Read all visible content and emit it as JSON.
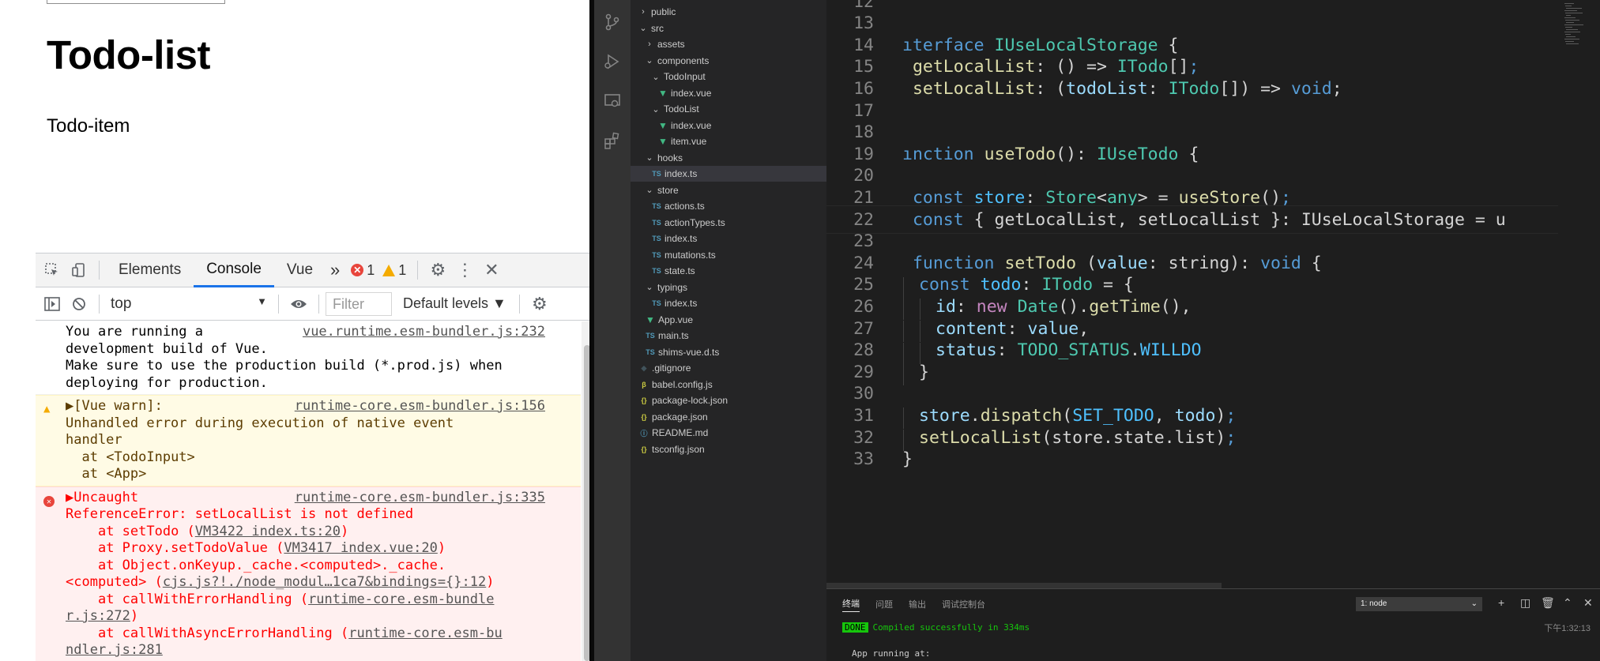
{
  "browser": {
    "page_title": "Todo-list",
    "page_item": "Todo-item",
    "devtools": {
      "tabs": [
        "Elements",
        "Console",
        "Vue"
      ],
      "more": "»",
      "error_count": "1",
      "warning_count": "1",
      "context": "top",
      "filter_placeholder": "Filter",
      "levels": "Default levels ▼"
    },
    "console": [
      {
        "type": "info",
        "source": "vue.runtime.esm-bundler.js:232",
        "text": "You are running a\ndevelopment build of Vue.\nMake sure to use the production build (*.prod.js) when\ndeploying for production."
      },
      {
        "type": "warn",
        "source": "runtime-core.esm-bundler.js:156",
        "text": "▶[Vue warn]:\nUnhandled error during execution of native event\nhandler\n  at <TodoInput>\n  at <App>"
      },
      {
        "type": "err",
        "source": "runtime-core.esm-bundler.js:335",
        "head": "▶Uncaught",
        "line1": "ReferenceError: setLocalList is not defined",
        "line2_pre": "    at setTodo (",
        "line2_link": "VM3422 index.ts:20",
        "line2_post": ")",
        "line3_pre": "    at Proxy.setTodoValue (",
        "line3_link": "VM3417 index.vue:20",
        "line3_post": ")",
        "line4": "    at Object.onKeyup._cache.<computed>._cache.",
        "line5_pre": "<computed> (",
        "line5_link": "cjs.js?!./node_modul…1ca7&bindings={}:12",
        "line5_post": ")",
        "line6_pre": "    at callWithErrorHandling (",
        "line6_link": "runtime-core.esm-bundle",
        "line7_link": "r.js:272",
        "line7_post": ")",
        "line8_pre": "    at callWithAsyncErrorHandling (",
        "line8_link": "runtime-core.esm-bu",
        "line9_link": "ndler.js:281"
      }
    ]
  },
  "explorer": [
    {
      "indent": 0,
      "chev": "›",
      "icon": "",
      "label": "public"
    },
    {
      "indent": 0,
      "chev": "⌄",
      "icon": "",
      "label": "src"
    },
    {
      "indent": 1,
      "chev": "›",
      "icon": "",
      "label": "assets"
    },
    {
      "indent": 1,
      "chev": "⌄",
      "icon": "",
      "label": "components"
    },
    {
      "indent": 2,
      "chev": "⌄",
      "icon": "",
      "label": "TodoInput"
    },
    {
      "indent": 3,
      "chev": "",
      "icon": "vue",
      "label": "index.vue"
    },
    {
      "indent": 2,
      "chev": "⌄",
      "icon": "",
      "label": "TodoList"
    },
    {
      "indent": 3,
      "chev": "",
      "icon": "vue",
      "label": "index.vue"
    },
    {
      "indent": 3,
      "chev": "",
      "icon": "vue",
      "label": "item.vue"
    },
    {
      "indent": 1,
      "chev": "⌄",
      "icon": "",
      "label": "hooks"
    },
    {
      "indent": 2,
      "chev": "",
      "icon": "ts",
      "label": "index.ts",
      "selected": true
    },
    {
      "indent": 1,
      "chev": "⌄",
      "icon": "",
      "label": "store"
    },
    {
      "indent": 2,
      "chev": "",
      "icon": "ts",
      "label": "actions.ts"
    },
    {
      "indent": 2,
      "chev": "",
      "icon": "ts",
      "label": "actionTypes.ts"
    },
    {
      "indent": 2,
      "chev": "",
      "icon": "ts",
      "label": "index.ts"
    },
    {
      "indent": 2,
      "chev": "",
      "icon": "ts",
      "label": "mutations.ts"
    },
    {
      "indent": 2,
      "chev": "",
      "icon": "ts",
      "label": "state.ts"
    },
    {
      "indent": 1,
      "chev": "⌄",
      "icon": "",
      "label": "typings"
    },
    {
      "indent": 2,
      "chev": "",
      "icon": "ts",
      "label": "index.ts"
    },
    {
      "indent": 1,
      "chev": "",
      "icon": "vue",
      "label": "App.vue"
    },
    {
      "indent": 1,
      "chev": "",
      "icon": "ts",
      "label": "main.ts"
    },
    {
      "indent": 1,
      "chev": "",
      "icon": "ts",
      "label": "shims-vue.d.ts"
    },
    {
      "indent": 0,
      "chev": "",
      "icon": "git",
      "label": ".gitignore"
    },
    {
      "indent": 0,
      "chev": "",
      "icon": "babel",
      "label": "babel.config.js"
    },
    {
      "indent": 0,
      "chev": "",
      "icon": "json",
      "label": "package-lock.json"
    },
    {
      "indent": 0,
      "chev": "",
      "icon": "json",
      "label": "package.json"
    },
    {
      "indent": 0,
      "chev": "",
      "icon": "info",
      "label": "README.md"
    },
    {
      "indent": 0,
      "chev": "",
      "icon": "json",
      "label": "tsconfig.json"
    }
  ],
  "editor": {
    "lines": [
      {
        "n": "12",
        "indent": 0,
        "tokens": []
      },
      {
        "n": "13",
        "indent": 0,
        "tokens": []
      },
      {
        "n": "14",
        "indent": 0,
        "tokens": [
          [
            "k",
            "ıterface "
          ],
          [
            "t",
            "IUseLocalStorage"
          ],
          [
            "s",
            " {"
          ]
        ]
      },
      {
        "n": "15",
        "indent": 0,
        "tokens": [
          [
            "s",
            " "
          ],
          [
            "f",
            "getLocalList"
          ],
          [
            "s",
            ": () => "
          ],
          [
            "t",
            "ITodo"
          ],
          [
            "s",
            "[]"
          ],
          [
            "k",
            ";"
          ]
        ]
      },
      {
        "n": "16",
        "indent": 0,
        "tokens": [
          [
            "s",
            " "
          ],
          [
            "f",
            "setLocalList"
          ],
          [
            "s",
            ": ("
          ],
          [
            "v",
            "todoList"
          ],
          [
            "s",
            ": "
          ],
          [
            "t",
            "ITodo"
          ],
          [
            "s",
            "[]) => "
          ],
          [
            "k",
            "void"
          ],
          [
            "s",
            ";"
          ]
        ]
      },
      {
        "n": "17",
        "indent": 0,
        "tokens": []
      },
      {
        "n": "18",
        "indent": 0,
        "tokens": []
      },
      {
        "n": "19",
        "indent": 0,
        "tokens": [
          [
            "k",
            "ınction "
          ],
          [
            "f",
            "useTodo"
          ],
          [
            "s",
            "(): "
          ],
          [
            "t",
            "IUseTodo"
          ],
          [
            "s",
            " {"
          ]
        ]
      },
      {
        "n": "20",
        "indent": 0,
        "tokens": []
      },
      {
        "n": "21",
        "indent": 0,
        "tokens": [
          [
            "s",
            " "
          ],
          [
            "k",
            "const "
          ],
          [
            "c",
            "store"
          ],
          [
            "s",
            ": "
          ],
          [
            "t",
            "Store"
          ],
          [
            "s",
            "<"
          ],
          [
            "t",
            "any"
          ],
          [
            "s",
            "> = "
          ],
          [
            "f",
            "useStore"
          ],
          [
            "s",
            "()"
          ],
          [
            "k",
            ";"
          ]
        ]
      },
      {
        "n": "22",
        "indent": 0,
        "hl": true,
        "tokens": [
          [
            "s",
            " "
          ],
          [
            "k",
            "const "
          ],
          [
            "s",
            "{ getLocalList, setLocalList }: IUseLocalStorage = u"
          ]
        ]
      },
      {
        "n": "23",
        "indent": 0,
        "tokens": []
      },
      {
        "n": "24",
        "indent": 0,
        "tokens": [
          [
            "s",
            " "
          ],
          [
            "k",
            "function "
          ],
          [
            "f",
            "setTodo"
          ],
          [
            "s",
            " ("
          ],
          [
            "v",
            "value"
          ],
          [
            "s",
            ": string): "
          ],
          [
            "k",
            "void"
          ],
          [
            "s",
            " {"
          ]
        ]
      },
      {
        "n": "25",
        "indent": 1,
        "tokens": [
          [
            "k",
            "const "
          ],
          [
            "c",
            "todo"
          ],
          [
            "s",
            ": "
          ],
          [
            "t",
            "ITodo"
          ],
          [
            "s",
            " = {"
          ]
        ]
      },
      {
        "n": "26",
        "indent": 2,
        "tokens": [
          [
            "v",
            "id"
          ],
          [
            "s",
            ": "
          ],
          [
            "kc",
            "new "
          ],
          [
            "t",
            "Date"
          ],
          [
            "s",
            "()."
          ],
          [
            "f",
            "getTime"
          ],
          [
            "s",
            "(),"
          ]
        ]
      },
      {
        "n": "27",
        "indent": 2,
        "tokens": [
          [
            "v",
            "content"
          ],
          [
            "s",
            ": "
          ],
          [
            "v",
            "value"
          ],
          [
            "s",
            ","
          ]
        ]
      },
      {
        "n": "28",
        "indent": 2,
        "tokens": [
          [
            "v",
            "status"
          ],
          [
            "s",
            ": "
          ],
          [
            "t",
            "TODO_STATUS"
          ],
          [
            "s",
            "."
          ],
          [
            "c",
            "WILLDO"
          ]
        ]
      },
      {
        "n": "29",
        "indent": 1,
        "tokens": [
          [
            "s",
            "}"
          ]
        ]
      },
      {
        "n": "30",
        "indent": 0,
        "tokens": []
      },
      {
        "n": "31",
        "indent": 1,
        "tokens": [
          [
            "v",
            "store"
          ],
          [
            "s",
            "."
          ],
          [
            "f",
            "dispatch"
          ],
          [
            "s",
            "("
          ],
          [
            "c",
            "SET_TODO"
          ],
          [
            "s",
            ", "
          ],
          [
            "v",
            "todo"
          ],
          [
            "s",
            ")"
          ],
          [
            "k",
            ";"
          ]
        ]
      },
      {
        "n": "32",
        "indent": 1,
        "tokens": [
          [
            "f",
            "setLocalList"
          ],
          [
            "s",
            "(store.state.list)"
          ],
          [
            "k",
            ";"
          ]
        ]
      },
      {
        "n": "33",
        "indent": 0,
        "tokens": [
          [
            "s",
            "}"
          ]
        ]
      }
    ]
  },
  "panel": {
    "tabs": [
      "终端",
      "问题",
      "输出",
      "调试控制台"
    ],
    "terminal_select": "1: node",
    "done_badge": "DONE",
    "compiled": "Compiled successfully in 334ms",
    "time": "下午1:32:13",
    "running": "App running at:"
  },
  "colors": {
    "accent": "#1a73e8",
    "error": "#ff0000",
    "warn_bg": "#fffbe5",
    "err_bg": "#fff0f0",
    "editor_bg": "#1e1e1e",
    "done_green": "#16c60c"
  }
}
